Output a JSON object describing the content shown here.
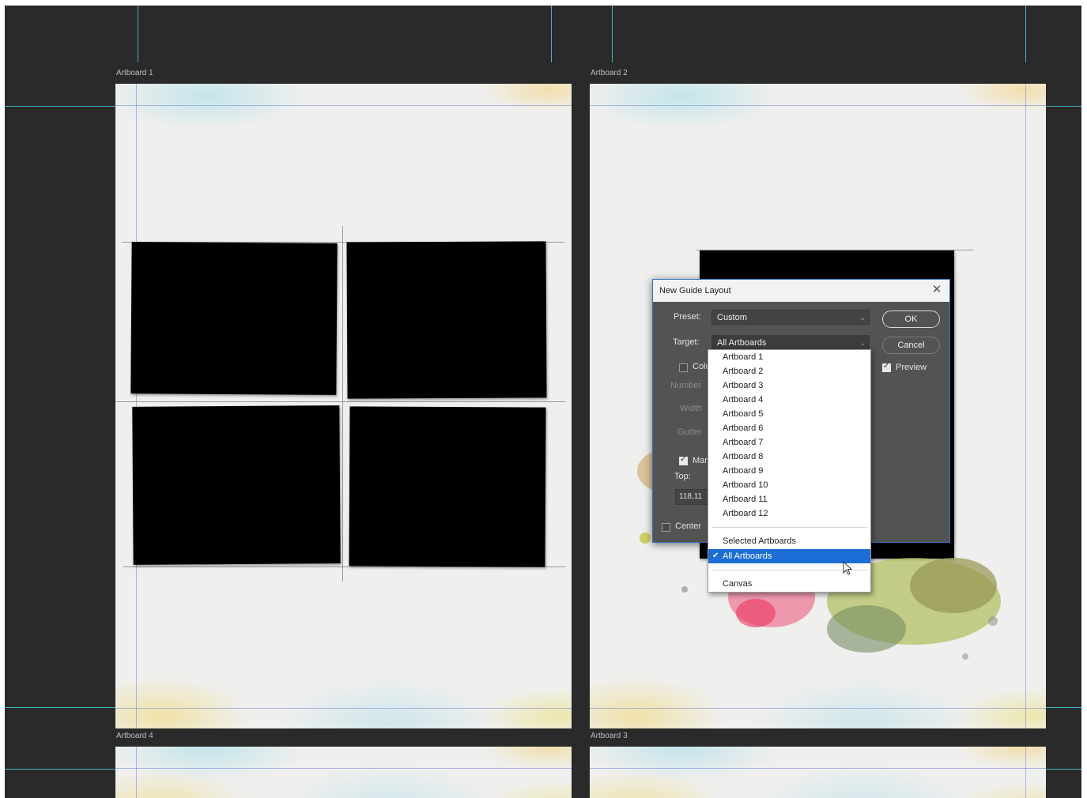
{
  "artboards": {
    "top_left": "Artboard 1",
    "top_right": "Artboard 2",
    "bottom_left": "Artboard 4",
    "bottom_right": "Artboard 3"
  },
  "dialog": {
    "title": "New Guide Layout",
    "close_glyph": "✕",
    "preset_label": "Preset:",
    "preset_value": "Custom",
    "target_label": "Target:",
    "target_value": "All Artboards",
    "columns_label": "Colu",
    "number_label": "Number",
    "width_label": "Width",
    "gutter_label": "Gutter",
    "margin_label": "Mar",
    "top_label": "Top:",
    "top_value": "118,11",
    "center_label": "Center",
    "ok_label": "OK",
    "cancel_label": "Cancel",
    "preview_label": "Preview",
    "preview_checked": true,
    "columns_checked": false,
    "margin_checked": true,
    "center_checked": false
  },
  "dropdown": {
    "artboard_items": [
      "Artboard 1",
      "Artboard 2",
      "Artboard 3",
      "Artboard 4",
      "Artboard 5",
      "Artboard 6",
      "Artboard 7",
      "Artboard 8",
      "Artboard 9",
      "Artboard 10",
      "Artboard 11",
      "Artboard 12"
    ],
    "selected_artboards": "Selected Artboards",
    "all_artboards": "All Artboards",
    "canvas": "Canvas",
    "check_glyph": "✔"
  },
  "colors": {
    "canvas_bg": "#2a2a2a",
    "guide": "#3fb6c8",
    "dialog_bg": "#535353",
    "selection": "#1c6ed6"
  }
}
